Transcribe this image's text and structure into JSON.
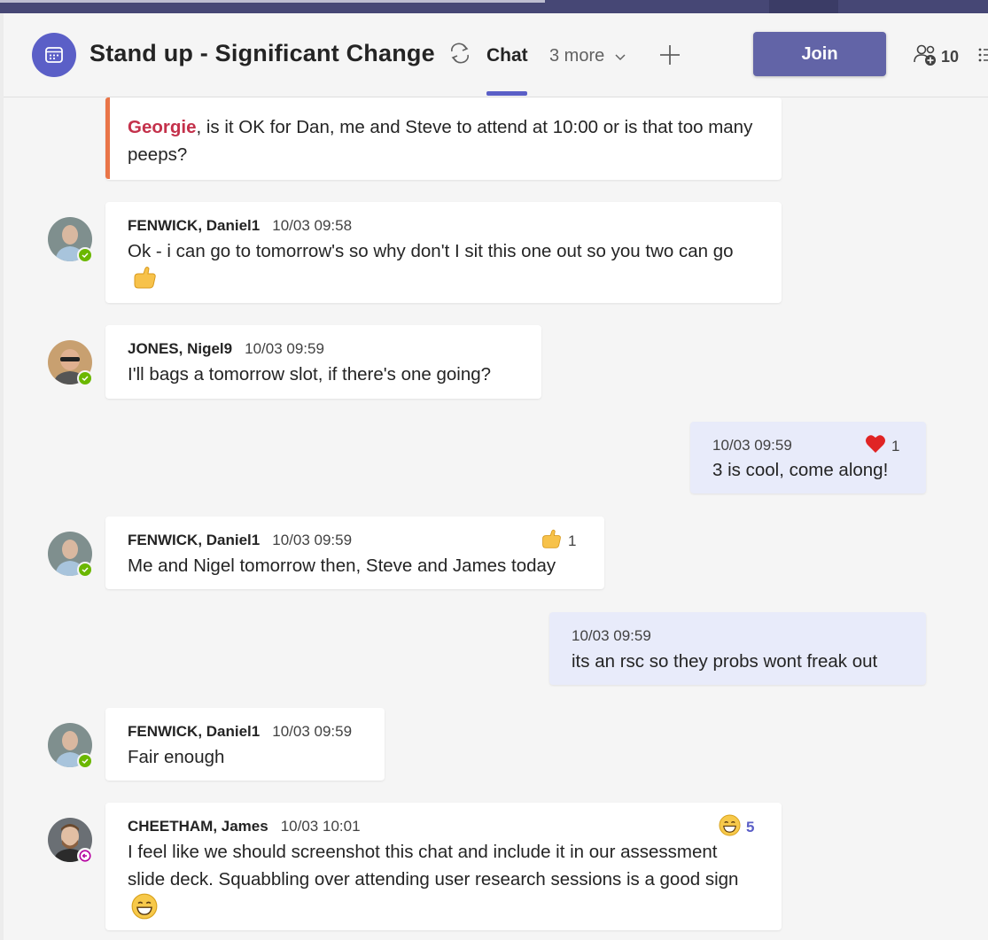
{
  "header": {
    "title": "Stand up - Significant Change",
    "tabs": [
      {
        "label": "Chat"
      },
      {
        "label": "3 more"
      }
    ],
    "join_label": "Join",
    "participants_count": "10",
    "icons": [
      "calendar-icon",
      "recurring-icon",
      "chevron-down-icon",
      "add-tab-icon",
      "add-people-icon",
      "more-options-icon"
    ]
  },
  "messages": [
    {
      "mention": "Georgie",
      "text": ", is it OK for Dan, me and Steve to attend at 10:00 or is that too many peeps?"
    },
    {
      "author": "FENWICK, Daniel1",
      "time": "10/03 09:58",
      "text": "Ok - i can go to tomorrow's so why don't I sit this one out so you two can go",
      "emoji": "thumbs-up-icon",
      "status": "available"
    },
    {
      "author": "JONES, Nigel9",
      "time": "10/03 09:59",
      "text": "I'll bags a tomorrow slot, if there's one going?",
      "status": "available"
    },
    {
      "time": "10/03 09:59",
      "text": "3 is cool, come along!",
      "reaction": {
        "icon": "heart-icon",
        "count": "1"
      },
      "mine": true
    },
    {
      "author": "FENWICK, Daniel1",
      "time": "10/03 09:59",
      "text": "Me and Nigel tomorrow then, Steve and James today",
      "reaction": {
        "icon": "thumbs-up-icon",
        "count": "1"
      },
      "status": "available"
    },
    {
      "time": "10/03 09:59",
      "text": "its an rsc so they probs wont freak out",
      "mine": true
    },
    {
      "author": "FENWICK, Daniel1",
      "time": "10/03 09:59",
      "text": "Fair enough",
      "status": "available"
    },
    {
      "author": "CHEETHAM, James",
      "time": "10/03 10:01",
      "text": "I feel like we should screenshot this chat and include it in our assessment slide deck. Squabbling over attending user research sessions is a good sign",
      "emoji": "grinning-face-icon",
      "reaction": {
        "icon": "grinning-face-icon",
        "count": "5"
      },
      "status": "out-of-office"
    }
  ],
  "colors": {
    "brand": "#6264a7",
    "accent": "#5b5fc7",
    "mention": "#c4314b",
    "quote_bar": "#e97548",
    "my_bubble": "#e8ebfa",
    "available": "#6bb700",
    "out_of_office": "#b4009e"
  }
}
